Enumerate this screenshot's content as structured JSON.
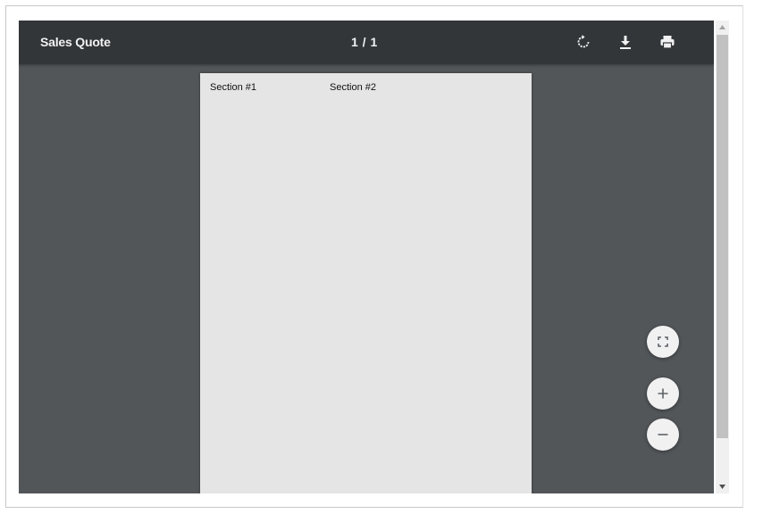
{
  "toolbar": {
    "title": "Sales Quote",
    "page_indicator": "1 / 1",
    "rotate_icon": "rotate-icon",
    "download_icon": "download-icon",
    "print_icon": "print-icon"
  },
  "page": {
    "sections": [
      "Section #1",
      "Section #2"
    ]
  },
  "controls": {
    "fit_icon": "fit-to-page-icon",
    "zoom_in_icon": "plus-icon",
    "zoom_out_icon": "minus-icon"
  },
  "colors": {
    "toolbar_bg": "#323639",
    "viewer_bg": "#525659",
    "page_bg": "#e5e5e5",
    "toolbar_text": "#f1f1f1"
  }
}
